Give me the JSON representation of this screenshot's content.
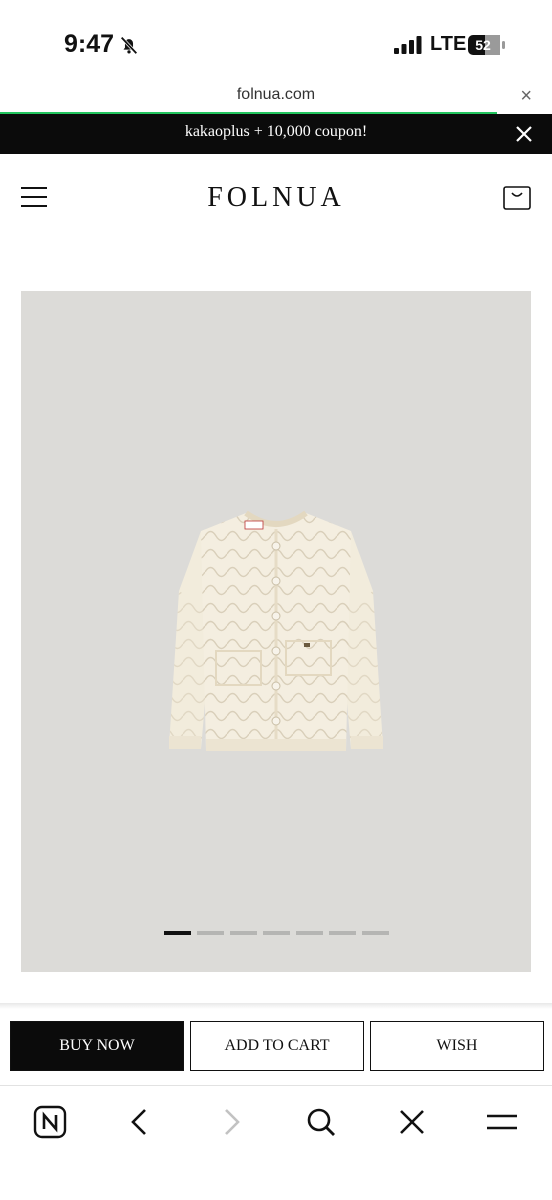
{
  "status_bar": {
    "time": "9:47",
    "carrier": "LTE",
    "battery": "52"
  },
  "browser": {
    "url": "folnua.com",
    "close_glyph": "×",
    "load_progress": 0.9
  },
  "promo": {
    "text": "kakaoplus + 10,000 coupon!"
  },
  "header": {
    "logo": "FOLNUA"
  },
  "gallery": {
    "total_slides": 7,
    "active_slide": 1,
    "background_color": "#dcdbd8",
    "product_color": "#f1ead8"
  },
  "actions": {
    "buy_now": "BUY NOW",
    "add_to_cart": "ADD TO CART",
    "wish": "WISH"
  },
  "toolbar": {
    "icons": [
      "naver-icon",
      "back-icon",
      "forward-icon",
      "search-icon",
      "close-icon",
      "menu-icon"
    ]
  },
  "colors": {
    "accent_progress": "#22c55e",
    "banner_bg": "#0b0b0b"
  }
}
